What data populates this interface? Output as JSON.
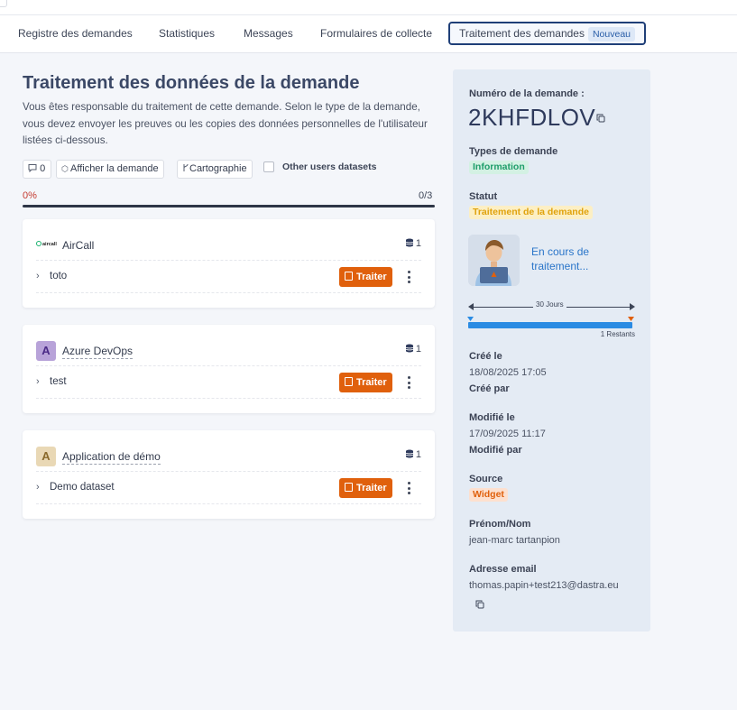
{
  "tabs": [
    {
      "label": "Registre des demandes"
    },
    {
      "label": "Statistiques"
    },
    {
      "label": "Messages"
    },
    {
      "label": "Formulaires de collecte"
    },
    {
      "label": "Traitement des demandes",
      "badge": "Nouveau",
      "active": true
    }
  ],
  "main": {
    "title": "Traitement des données de la demande",
    "description": "Vous êtes responsable du traitement de cette demande. Selon le type de la demande, vous devez envoyer les preuves ou les copies des données personnelles de l'utilisateur listées ci-dessous.",
    "toolbar": {
      "comments_count": "0",
      "show_request_label": "Afficher la demande",
      "mapping_label": "Cartographie",
      "other_users_label": "Other users datasets",
      "other_users_checked": false
    },
    "progress": {
      "percent_label": "0%",
      "count_label": "0/3",
      "completed_fraction": 0
    },
    "applications": [
      {
        "name": "AirCall",
        "logo_text": "aircall",
        "count": "1",
        "datasets": [
          {
            "label": "toto",
            "action": "Traiter"
          }
        ]
      },
      {
        "name": "Azure DevOps",
        "logo_text": "A",
        "count": "1",
        "datasets": [
          {
            "label": "test",
            "action": "Traiter"
          }
        ]
      },
      {
        "name": "Application de démo",
        "logo_text": "A",
        "count": "1",
        "datasets": [
          {
            "label": "Demo dataset",
            "action": "Traiter"
          }
        ]
      }
    ]
  },
  "panel": {
    "request_number_label": "Numéro de la demande :",
    "request_number": "2KHFDLOV",
    "request_types_label": "Types de demande",
    "request_type": "Information",
    "status_label": "Statut",
    "status": "Traitement de la demande",
    "status_message": "En cours de traitement...",
    "deadline_label": "30 Jours",
    "remaining_label": "1 Restants",
    "created_on_label": "Créé le",
    "created_on": "18/08/2025 17:05",
    "created_by_label": "Créé par",
    "modified_on_label": "Modifié le",
    "modified_on": "17/09/2025 11:17",
    "modified_by_label": "Modifié par",
    "source_label": "Source",
    "source": "Widget",
    "name_label": "Prénom/Nom",
    "name": "jean-marc tartanpion",
    "email_label": "Adresse email",
    "email": "thomas.papin+test213@dastra.eu"
  },
  "colors": {
    "accent_orange": "#e0600c",
    "active_tab_border": "#1f3f78",
    "link_blue": "#2a75c9",
    "panel_bg": "#e4ebf4",
    "type_pill_bg": "#d3f1e3",
    "status_pill_bg": "#fcefc4",
    "source_pill_bg": "#fde0cf"
  }
}
